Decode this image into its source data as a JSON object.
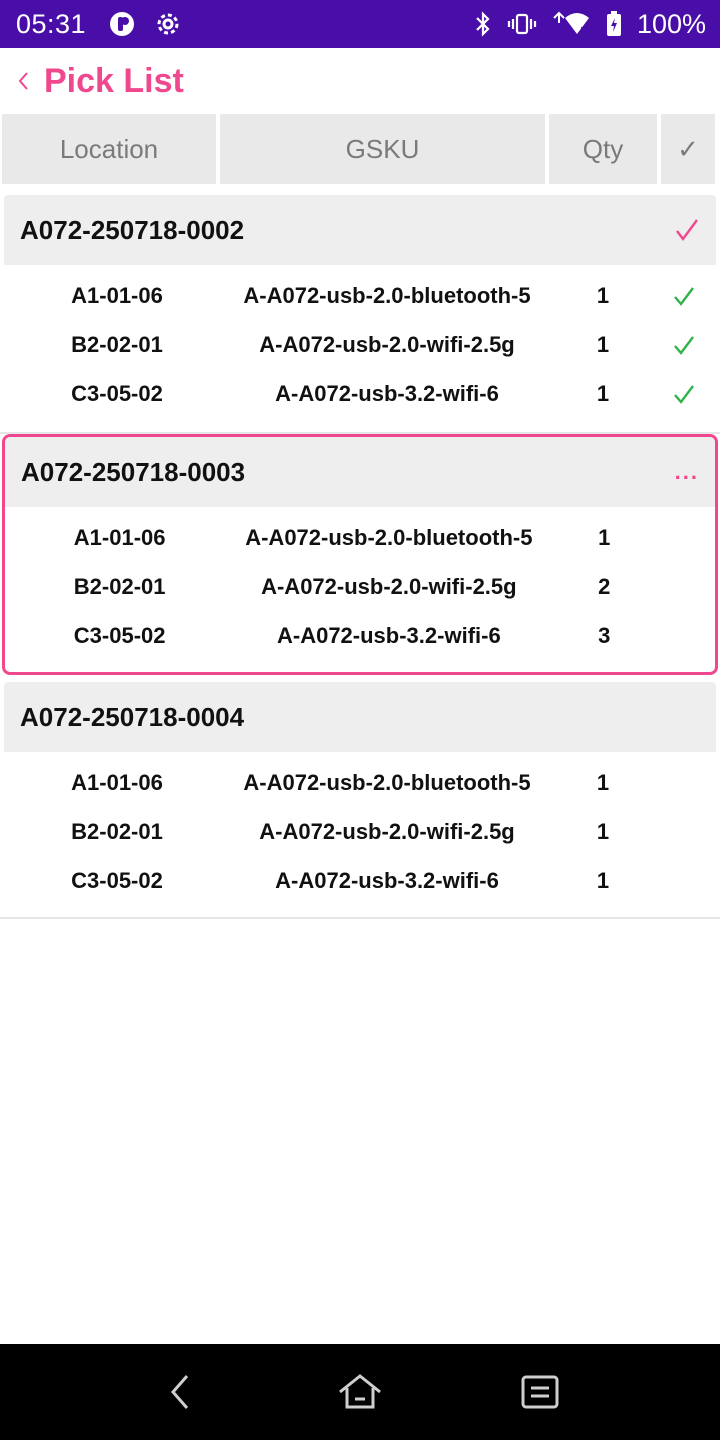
{
  "status_bar": {
    "time": "05:31",
    "battery": "100%",
    "icons_left": [
      "app-badge-icon",
      "settings-icon"
    ],
    "icons_right": [
      "bluetooth-icon",
      "vibrate-icon",
      "wifi-icon",
      "battery-icon"
    ],
    "bg_color": "#4a0ea8"
  },
  "app_bar": {
    "title": "Pick List",
    "accent_color": "#f0488e"
  },
  "columns": {
    "location": "Location",
    "gsku": "GSKU",
    "qty": "Qty",
    "check": "✓"
  },
  "orders": [
    {
      "id": "A072-250718-0002",
      "status": "done",
      "items": [
        {
          "location": "A1-01-06",
          "gsku": "A-A072-usb-2.0-bluetooth-5",
          "qty": "1",
          "picked": true
        },
        {
          "location": "B2-02-01",
          "gsku": "A-A072-usb-2.0-wifi-2.5g",
          "qty": "1",
          "picked": true
        },
        {
          "location": "C3-05-02",
          "gsku": "A-A072-usb-3.2-wifi-6",
          "qty": "1",
          "picked": true
        }
      ]
    },
    {
      "id": "A072-250718-0003",
      "status": "in-progress",
      "status_text": "...",
      "items": [
        {
          "location": "A1-01-06",
          "gsku": "A-A072-usb-2.0-bluetooth-5",
          "qty": "1",
          "picked": false
        },
        {
          "location": "B2-02-01",
          "gsku": "A-A072-usb-2.0-wifi-2.5g",
          "qty": "2",
          "picked": false
        },
        {
          "location": "C3-05-02",
          "gsku": "A-A072-usb-3.2-wifi-6",
          "qty": "3",
          "picked": false
        }
      ]
    },
    {
      "id": "A072-250718-0004",
      "status": "pending",
      "items": [
        {
          "location": "A1-01-06",
          "gsku": "A-A072-usb-2.0-bluetooth-5",
          "qty": "1",
          "picked": false
        },
        {
          "location": "B2-02-01",
          "gsku": "A-A072-usb-2.0-wifi-2.5g",
          "qty": "1",
          "picked": false
        },
        {
          "location": "C3-05-02",
          "gsku": "A-A072-usb-3.2-wifi-6",
          "qty": "1",
          "picked": false
        }
      ]
    }
  ],
  "colors": {
    "check_green": "#2fb34a",
    "check_pink": "#f0488e"
  },
  "nav_bar": {
    "buttons": [
      "back-icon",
      "home-icon",
      "recents-icon"
    ]
  }
}
